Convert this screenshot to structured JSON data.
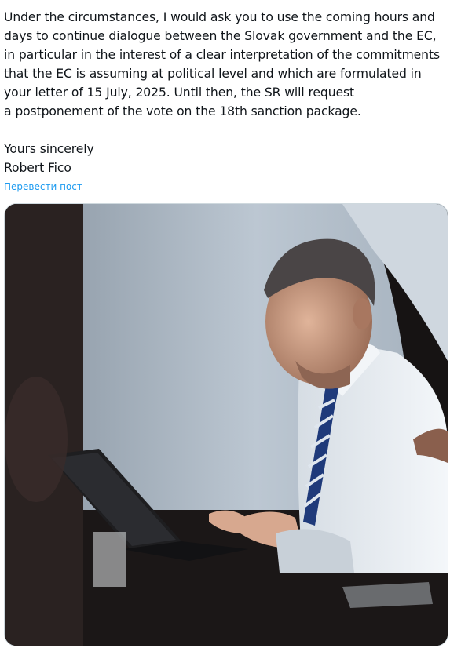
{
  "post": {
    "paragraph1": [
      "Under the circumstances, I would ask you to use the coming hours and",
      "days to continue dialogue between the Slovak government and the EC,",
      "in particular in the interest of a clear interpretation of the commitments",
      "that the EC is assuming at political level and which are formulated in",
      "your letter of 15 July, 2025. Until then, the SR will request",
      "a postponement of the vote on the 18th sanction package."
    ],
    "closing": "Yours sincerely",
    "signature": "Robert Fico",
    "translate_link": "Перевести пост"
  },
  "media": {
    "icon": "photo-icon",
    "colors": {
      "wall": "#b9c4cf",
      "shirt": "#e9eef3",
      "tie_stripe": "#1e3a78",
      "background": "#141212"
    }
  }
}
